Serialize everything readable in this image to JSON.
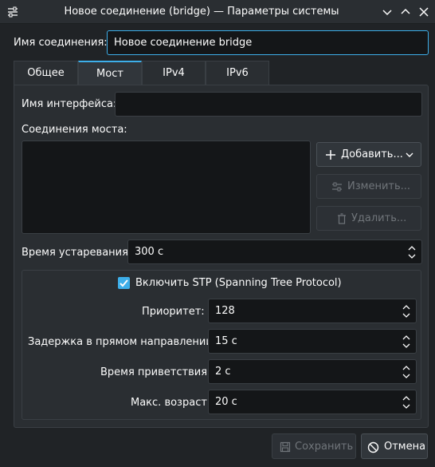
{
  "window": {
    "title": "Новое соединение (bridge) — Параметры системы"
  },
  "connection": {
    "label": "Имя соединения:",
    "value": "Новое соединение bridge"
  },
  "tabs": [
    {
      "label": "Общее",
      "active": false
    },
    {
      "label": "Мост",
      "active": true
    },
    {
      "label": "IPv4",
      "active": false
    },
    {
      "label": "IPv6",
      "active": false
    }
  ],
  "bridge": {
    "interface_label": "Имя интерфейса:",
    "interface_value": "",
    "connections_label": "Соединения моста:",
    "add_label": "Добавить...",
    "edit_label": "Изменить...",
    "delete_label": "Удалить...",
    "aging_label": "Время устаревания:",
    "aging_value": "300 с"
  },
  "stp": {
    "checkbox_label": "Включить STP (Spanning Tree Protocol)",
    "checked": true,
    "priority_label": "Приоритет:",
    "priority_value": "128",
    "forward_delay_label": "Задержка в прямом направлении:",
    "forward_delay_value": "15 с",
    "hello_time_label": "Время приветствия:",
    "hello_time_value": "2 с",
    "max_age_label": "Макс. возраст:",
    "max_age_value": "20 с"
  },
  "footer": {
    "save_label": "Сохранить",
    "cancel_label": "Отмена"
  },
  "colors": {
    "accent": "#3daee9",
    "window_bg": "#202326",
    "panel_bg": "#2a2e32",
    "field_bg": "#141618",
    "disabled_text": "#70757a"
  },
  "icons": {
    "app": "settings-sliders-icon",
    "collapse": "chevron-down-icon",
    "maximize": "chevron-up-icon",
    "close": "close-icon",
    "add": "plus-icon",
    "edit": "sliders-icon",
    "delete": "trash-icon",
    "save": "floppy-disk-icon",
    "cancel": "cancel-circle-icon"
  }
}
